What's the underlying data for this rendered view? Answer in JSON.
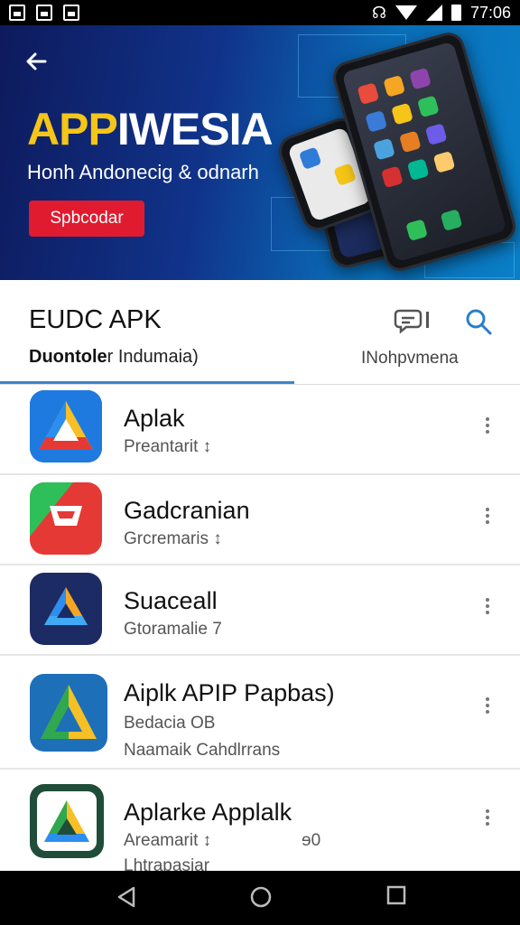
{
  "status": {
    "time": "77:06",
    "icons": [
      "image-icon",
      "sim-icon",
      "photo-icon",
      "vibrate-icon",
      "wifi-icon",
      "signal-icon",
      "battery-icon"
    ]
  },
  "banner": {
    "title_part1": "APP",
    "title_part2": "IWESIA",
    "subtitle": "Honh Andonecig & odnarh",
    "cta": "Spbcodar",
    "colors": {
      "accent": "#f5c518",
      "cta": "#e01b2f",
      "bg_dark": "#0e1a5c",
      "bg_light": "#0a7fc7"
    }
  },
  "header": {
    "title": "EUDC APK",
    "tab_left_bold": "Duontole",
    "tab_left_rest": "r Indumaia)",
    "tab_right": "INohpvmena"
  },
  "apps": [
    {
      "title": "Aplak",
      "subtitle": "Preantarit",
      "badge": "↕",
      "icon": "aplak-app-icon"
    },
    {
      "title": "Gadcranian",
      "subtitle": "Grcremaris",
      "badge": "↕",
      "icon": "gadcranian-app-icon"
    },
    {
      "title": "Suaceall",
      "subtitle": "Gtoramalie",
      "badge": "7",
      "icon": "suaceall-app-icon"
    },
    {
      "title": "Aiplk APIP Papbas)",
      "subtitle": "Bedacia OB",
      "subtitle2": "Naamaik   Cahdlrrans",
      "icon": "aiplk-app-icon"
    },
    {
      "title": "Aplarke Applalk",
      "subtitle": "Areamarit",
      "badge": "↕",
      "extra": "ɘ0",
      "subtitle2": "Lhtrapasiar",
      "icon": "aplarke-app-icon"
    }
  ]
}
